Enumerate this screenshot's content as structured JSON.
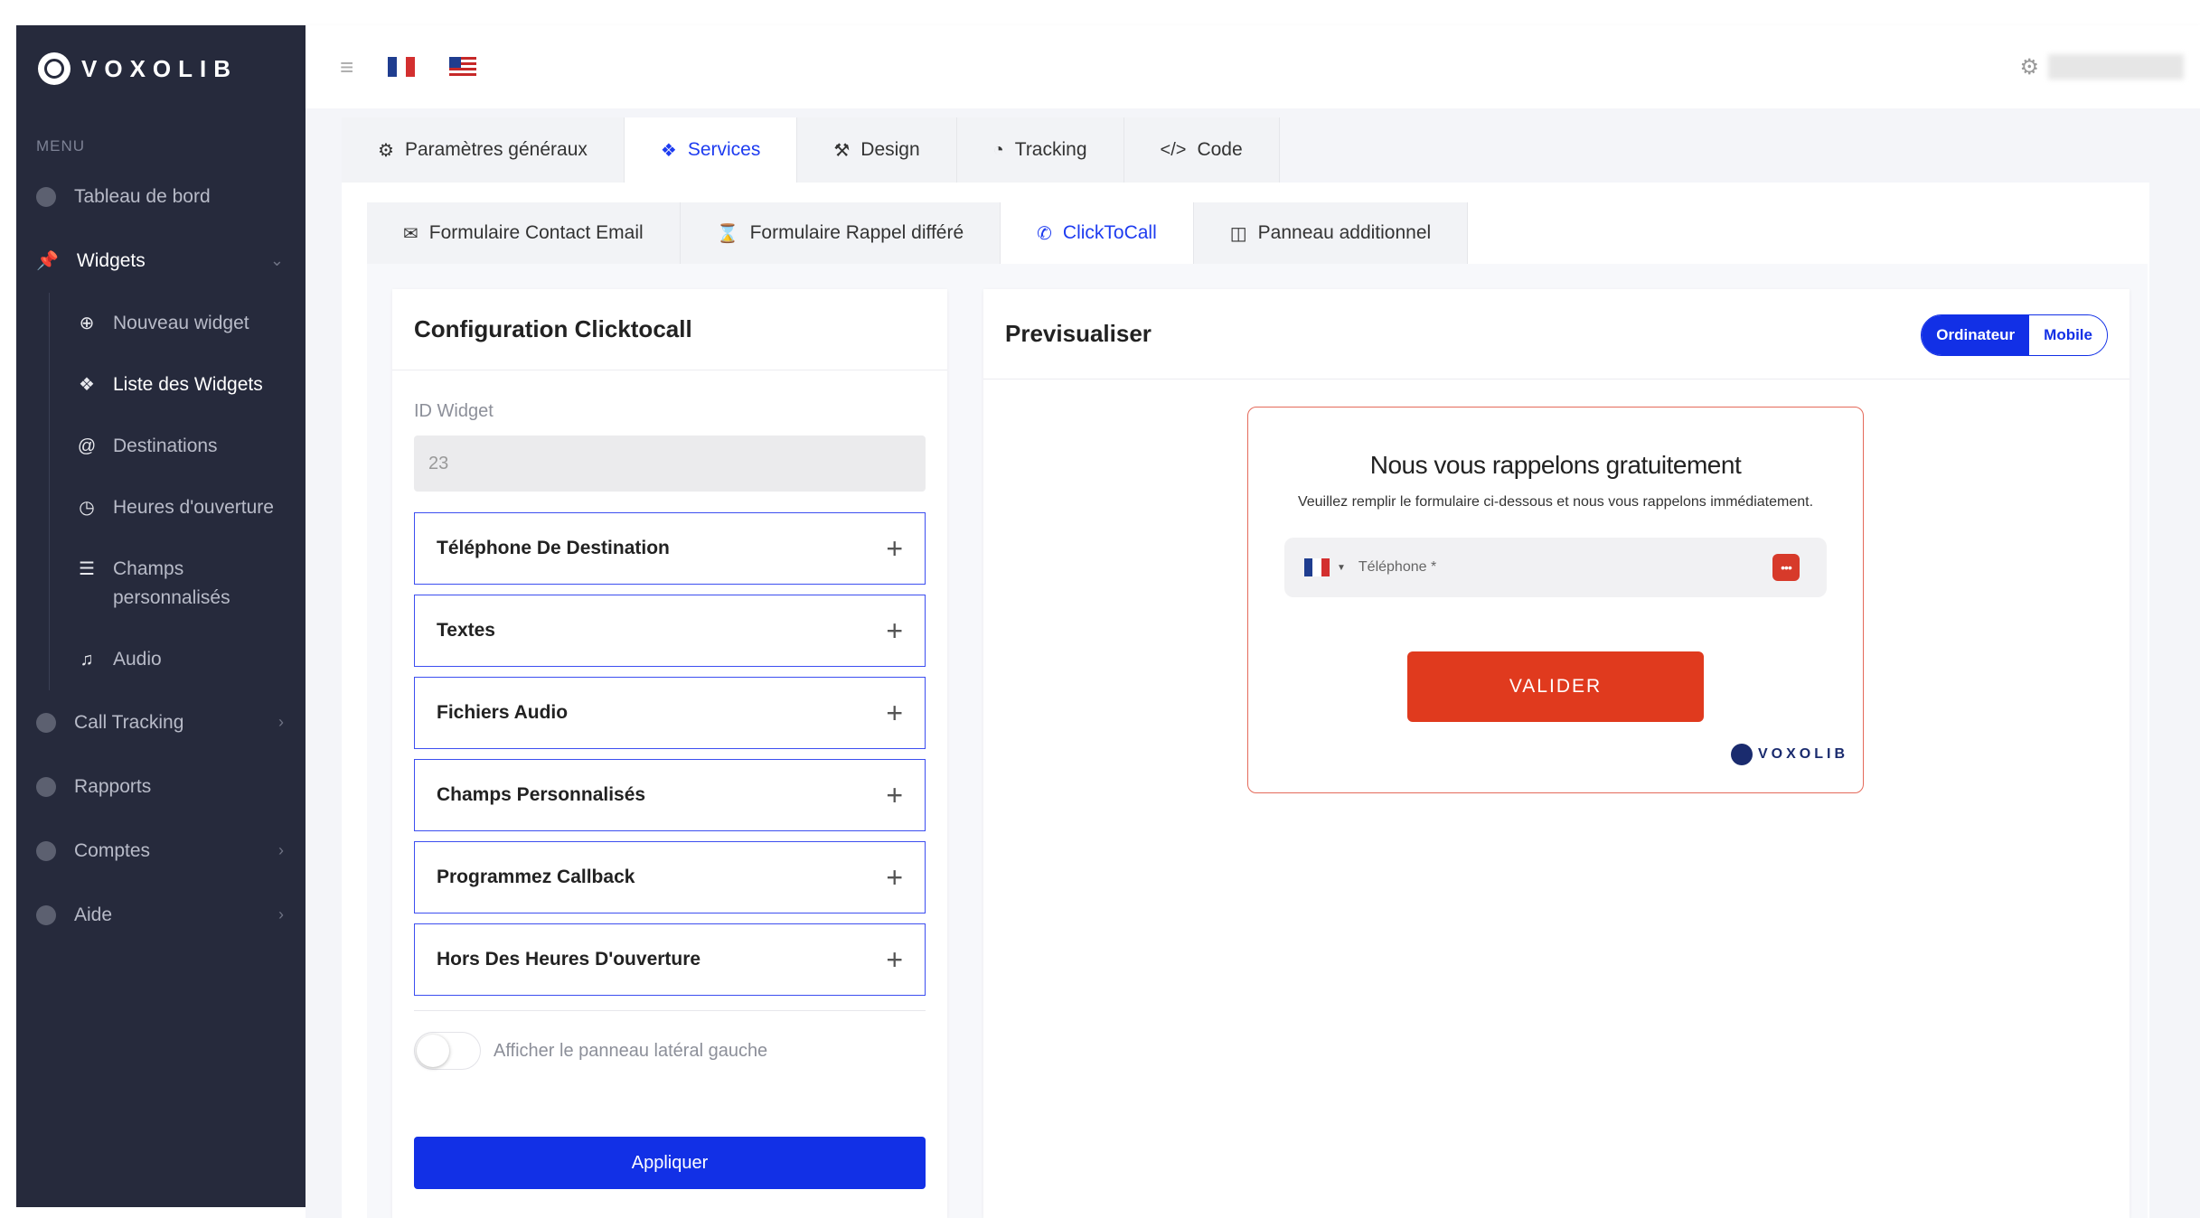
{
  "brand": {
    "name": "VOXOLIB"
  },
  "sidebar": {
    "menu_title": "MENU",
    "items": [
      {
        "label": "Tableau de bord"
      },
      {
        "label": "Widgets"
      },
      {
        "label": "Call Tracking"
      },
      {
        "label": "Rapports"
      },
      {
        "label": "Comptes"
      },
      {
        "label": "Aide"
      }
    ],
    "sub_items": [
      {
        "label": "Nouveau widget"
      },
      {
        "label": "Liste des Widgets"
      },
      {
        "label": "Destinations"
      },
      {
        "label": "Heures d'ouverture"
      },
      {
        "label": "Champs personnalisés"
      },
      {
        "label": "Audio"
      }
    ]
  },
  "tabs_main": [
    {
      "label": "Paramètres généraux"
    },
    {
      "label": "Services"
    },
    {
      "label": "Design"
    },
    {
      "label": "Tracking"
    },
    {
      "label": "Code"
    }
  ],
  "tabs_services": [
    {
      "label": "Formulaire Contact Email"
    },
    {
      "label": "Formulaire Rappel différé"
    },
    {
      "label": "ClickToCall"
    },
    {
      "label": "Panneau additionnel"
    }
  ],
  "config": {
    "title": "Configuration Clicktocall",
    "id_label": "ID Widget",
    "id_value": "23",
    "sections": [
      {
        "label": "Téléphone De Destination"
      },
      {
        "label": "Textes"
      },
      {
        "label": "Fichiers Audio"
      },
      {
        "label": "Champs Personnalisés"
      },
      {
        "label": "Programmez Callback"
      },
      {
        "label": "Hors Des Heures D'ouverture"
      }
    ],
    "toggle_label": "Afficher le panneau latéral gauche",
    "apply_label": "Appliquer"
  },
  "preview": {
    "title": "Previsualiser",
    "mode_desktop": "Ordinateur",
    "mode_mobile": "Mobile",
    "widget": {
      "heading": "Nous vous rappelons gratuitement",
      "subtext": "Veuillez remplir le formulaire ci-dessous et nous vous rappelons immédiatement.",
      "phone_placeholder": "Téléphone *",
      "button": "VALIDER",
      "brand": "VOXOLIB"
    }
  },
  "colors": {
    "accent": "#1230e6",
    "sidebar": "#262a3c",
    "cta": "#e03a1e"
  }
}
